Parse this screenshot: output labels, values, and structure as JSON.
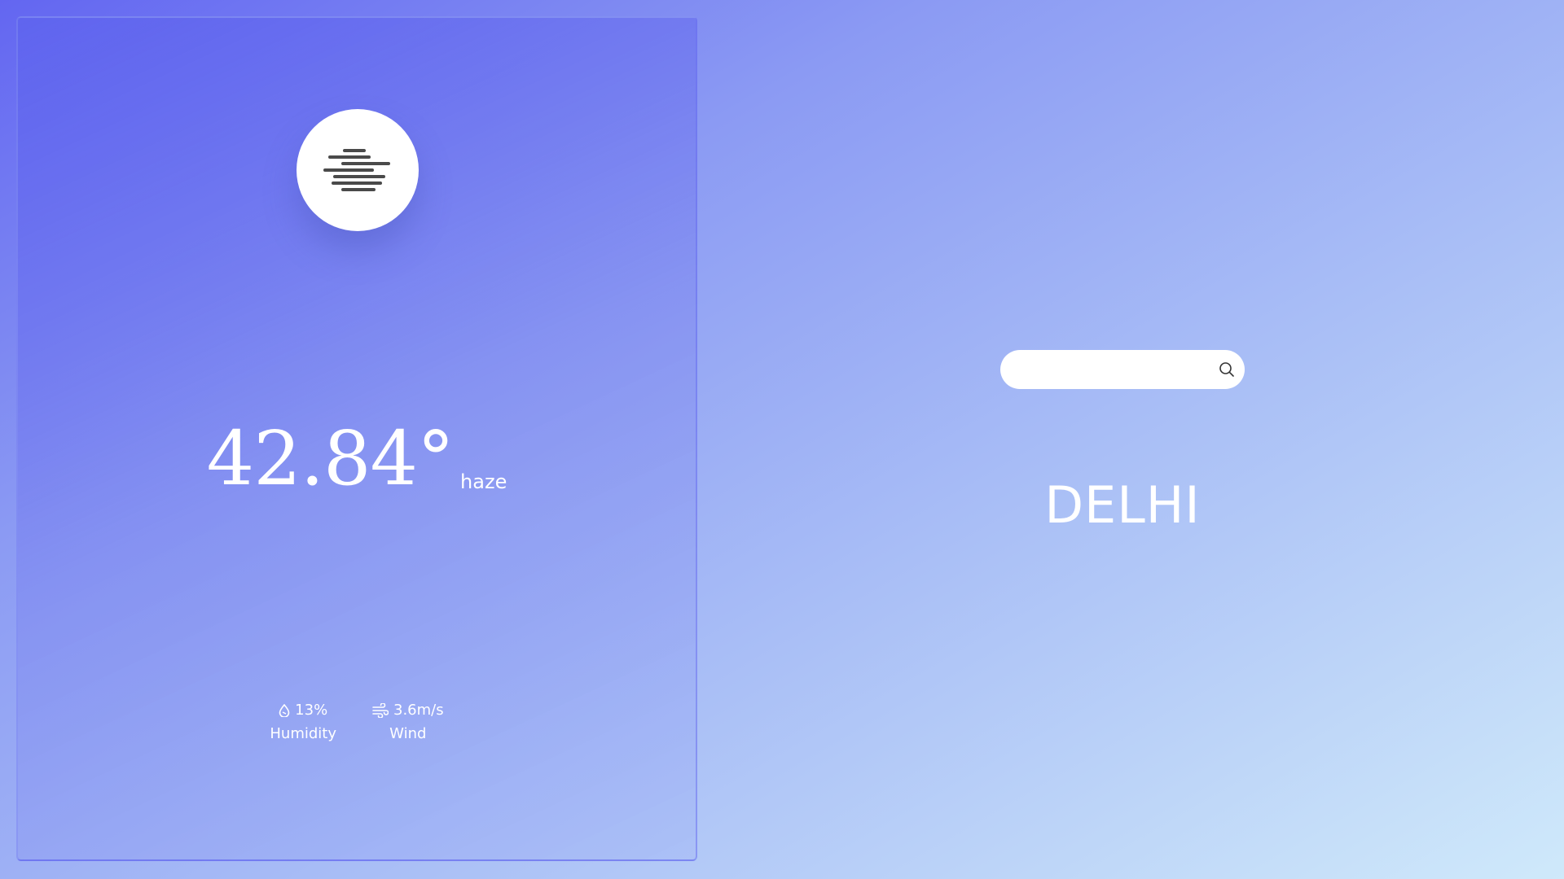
{
  "weather": {
    "temperature": "42.84°",
    "condition": "haze",
    "icon": "haze-icon",
    "humidity": {
      "value": "13%",
      "label": "Humidity",
      "icon": "droplet-icon"
    },
    "wind": {
      "value": "3.6m/s",
      "label": "Wind",
      "icon": "wind-icon"
    }
  },
  "search": {
    "value": "",
    "placeholder": "",
    "icon": "search-icon"
  },
  "city": {
    "name": "DELHI"
  },
  "colors": {
    "gradient_start": "#6366f1",
    "gradient_end": "#cfe9fa",
    "text": "#ffffff",
    "icon_stroke": "#4a4a4a"
  }
}
